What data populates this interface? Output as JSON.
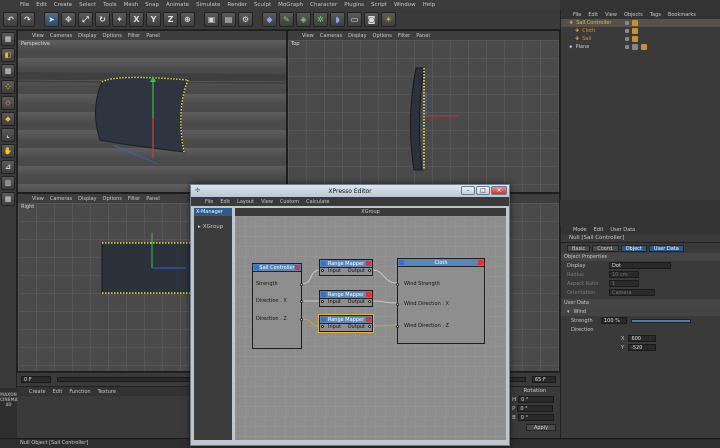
{
  "menubar": [
    "File",
    "Edit",
    "Create",
    "Select",
    "Tools",
    "Mesh",
    "Snap",
    "Animate",
    "Simulate",
    "Render",
    "Sculpt",
    "MoGraph",
    "Character",
    "Plugins",
    "Script",
    "Window",
    "Help"
  ],
  "toolbar": {
    "icons": [
      "undo-icon",
      "redo-icon",
      "live-select-icon",
      "move-icon",
      "scale-icon",
      "rotate-icon",
      "recent-icon",
      "x-axis-icon",
      "y-axis-icon",
      "z-axis-icon",
      "coord-system-icon",
      "render-view-icon",
      "render-picture-icon",
      "render-settings-icon",
      "cube-icon",
      "pen-icon",
      "subdivide-icon",
      "array-icon",
      "deformer-icon",
      "floor-icon",
      "camera-icon",
      "light-icon"
    ],
    "x_label": "X",
    "y_label": "Y",
    "z_label": "Z"
  },
  "viewport_menu": [
    "View",
    "Cameras",
    "Display",
    "Options",
    "Filter",
    "Panel"
  ],
  "viewports": {
    "perspective": "Perspective",
    "top": "Top",
    "right": "Right"
  },
  "object_manager": {
    "menu": [
      "File",
      "Edit",
      "View",
      "Objects",
      "Tags",
      "Bookmarks"
    ],
    "objects": [
      {
        "name": "Sail Controller",
        "selected": true
      },
      {
        "name": "Cloth",
        "selected": false
      },
      {
        "name": "Sail",
        "selected": false
      },
      {
        "name": "Plane",
        "selected": false
      }
    ]
  },
  "attribute_manager": {
    "menu": [
      "Mode",
      "Edit",
      "User Data"
    ],
    "title": "Null [Sail Controller]",
    "tabs": [
      "Basic",
      "Coord.",
      "Object",
      "User Data"
    ],
    "section_properties": "Object Properties",
    "display_label": "Display",
    "display_value": "Dot",
    "radius_label": "Radius",
    "radius_value": "10 cm",
    "aspect_label": "Aspect Ratio",
    "aspect_value": "1",
    "orientation_label": "Orientation",
    "orientation_value": "Camera",
    "section_userdata": "User Data",
    "wind_group": "Wind",
    "strength_label": "Strength",
    "strength_value": "100 %",
    "direction_label": "Direction",
    "dir_x_label": "X",
    "dir_x_value": "600",
    "dir_y_label": "Y",
    "dir_y_value": "-520"
  },
  "xpresso": {
    "title": "XPresso Editor",
    "menu": [
      "File",
      "Edit",
      "Layout",
      "View",
      "Custom",
      "Calculate"
    ],
    "left_tab": "X-Manager",
    "left_item": "XGroup",
    "canvas_title": "XGroup",
    "nodes": {
      "sail_controller": {
        "title": "Sail Controller",
        "ports": [
          "Strength",
          "Direction . X",
          "Direction . Z"
        ]
      },
      "range_mapper_1": {
        "title": "Range Mapper",
        "in": "Input",
        "out": "Output"
      },
      "range_mapper_2": {
        "title": "Range Mapper",
        "in": "Input",
        "out": "Output"
      },
      "range_mapper_3": {
        "title": "Range Mapper",
        "in": "Input",
        "out": "Output"
      },
      "cloth": {
        "title": "Cloth",
        "ports": [
          "Wind Strength",
          "Wind Direction . X",
          "Wind Direction . Z"
        ]
      }
    }
  },
  "timeline": {
    "start": "0 F",
    "end": "65 F"
  },
  "material_menu": [
    "Create",
    "Edit",
    "Function",
    "Texture"
  ],
  "coords": {
    "header": "Rotation",
    "rows": [
      {
        "axis": "H",
        "value": "0 °"
      },
      {
        "axis": "P",
        "value": "0 °"
      },
      {
        "axis": "B",
        "value": "0 °"
      }
    ],
    "apply": "Apply"
  },
  "status": "Null Object [Sail Controller]",
  "logo": "MAXON CINEMA 4D"
}
